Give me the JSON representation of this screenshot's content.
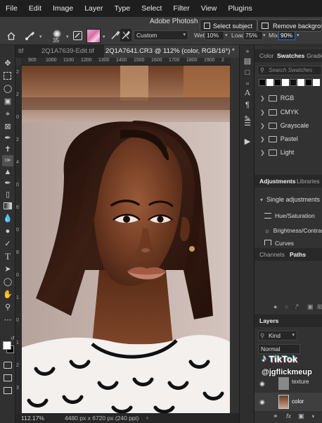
{
  "menubar": {
    "items": [
      "File",
      "Edit",
      "Image",
      "Layer",
      "Type",
      "Select",
      "Filter",
      "View",
      "Plugins"
    ]
  },
  "options": {
    "brush_size": "35",
    "preset": "Custom",
    "wet_label": "Wet:",
    "wet_value": "10%",
    "load_label": "Load:",
    "load_value": "75%",
    "mix_label": "Mix:",
    "mix_value": "90%",
    "app_title": "Adobe Photosh",
    "select_subject": "Select subject",
    "remove_background": "Remove backgroun"
  },
  "tabs": [
    {
      "label": "tif"
    },
    {
      "label": "2Q1A7639-Edit.tif"
    },
    {
      "label": "2Q1A7641.CR3 @ 112% (color, RGB/16*) *"
    }
  ],
  "rulers": {
    "top_ticks": [
      "900",
      "1000",
      "1100",
      "1200",
      "1300",
      "1400",
      "1500",
      "1600",
      "1700",
      "1800",
      "1900",
      "2"
    ],
    "left_ticks": [
      "2",
      "2",
      "0",
      "2",
      "4",
      "0",
      "6",
      "0",
      "8",
      "0",
      "1",
      "0",
      "1",
      "2",
      "3"
    ]
  },
  "status": {
    "zoom": "112.17%",
    "doc_size": "4480 px x 6720 px (240 ppi)"
  },
  "swatches_panel": {
    "tabs": [
      "Color",
      "Swatches",
      "Gradie"
    ],
    "active_tab": "Swatches",
    "search_placeholder": "Search Swatches",
    "folders": [
      "RGB",
      "CMYK",
      "Grayscale",
      "Pastel",
      "Light"
    ],
    "recent_colors": [
      "#000000",
      "#ffffff",
      "#000000",
      "#ffffff",
      "#111111",
      "#ffffff",
      "#000000",
      "#ffffff",
      "#000000"
    ]
  },
  "adjustments_panel": {
    "tabs": [
      "Adjustments",
      "Libraries"
    ],
    "section": "Single adjustments",
    "items": [
      "Hue/Saturation",
      "Brightness/Contrast",
      "Curves"
    ]
  },
  "channels_panel": {
    "tabs": [
      "Channels",
      "Paths"
    ],
    "active_tab": "Paths"
  },
  "layers_panel": {
    "title": "Layers",
    "kind_label": "Kind",
    "blend_mode": "Normal",
    "layers": [
      {
        "name": "texture"
      },
      {
        "name": "color"
      }
    ]
  },
  "watermark": {
    "brand": "TikTok",
    "handle": "@jgflickmeup"
  },
  "colors": {
    "accent": "#1473e6",
    "menubar_bg": "#1e1e1e",
    "panel_bg": "#323232"
  }
}
